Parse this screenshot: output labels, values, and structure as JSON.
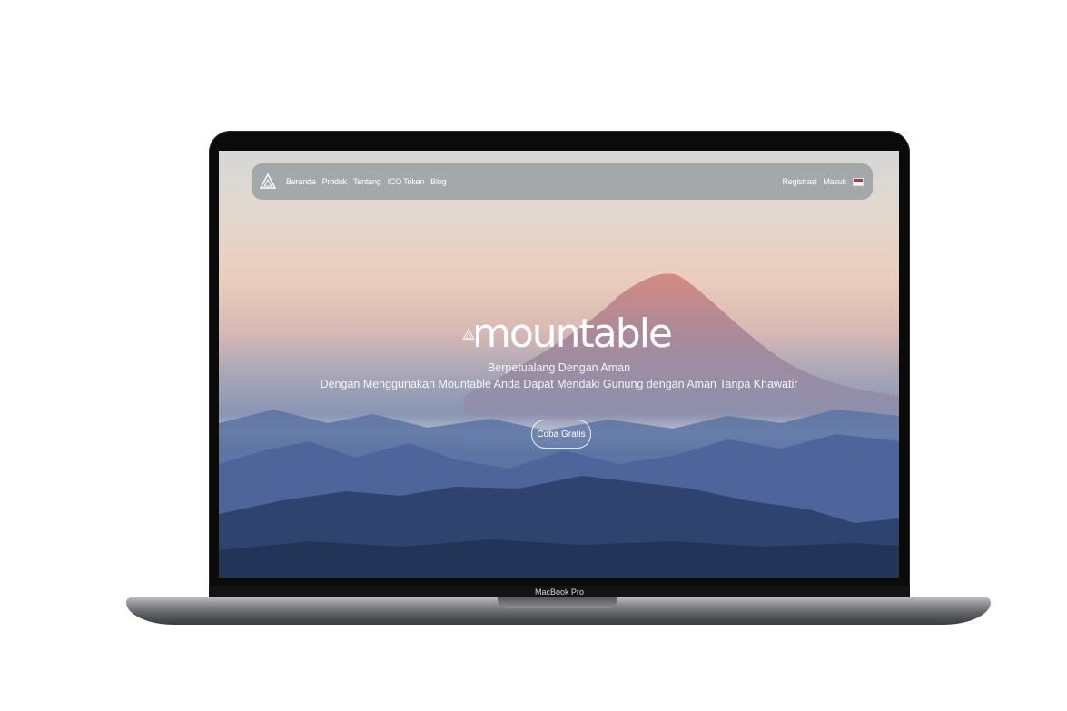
{
  "device": {
    "model_label": "MacBook Pro"
  },
  "site": {
    "nav": {
      "links": [
        "Beranda",
        "Produk",
        "Tentang",
        "ICO Token",
        "Blog"
      ],
      "right": {
        "register": "Registrasi",
        "login": "Masuk",
        "language_flag": "indonesia-flag"
      }
    },
    "hero": {
      "brand": "mountable",
      "tagline_1": "Berpetualang Dengan Aman",
      "tagline_2": "Dengan Menggunakan Mountable Anda Dapat Mendaki Gunung dengan Aman Tanpa Khawatir",
      "cta": "Coba Gratis"
    }
  },
  "colors": {
    "flag_red": "#e0242e",
    "navbar_bg": "#969ea0",
    "text_white": "#ffffff"
  }
}
